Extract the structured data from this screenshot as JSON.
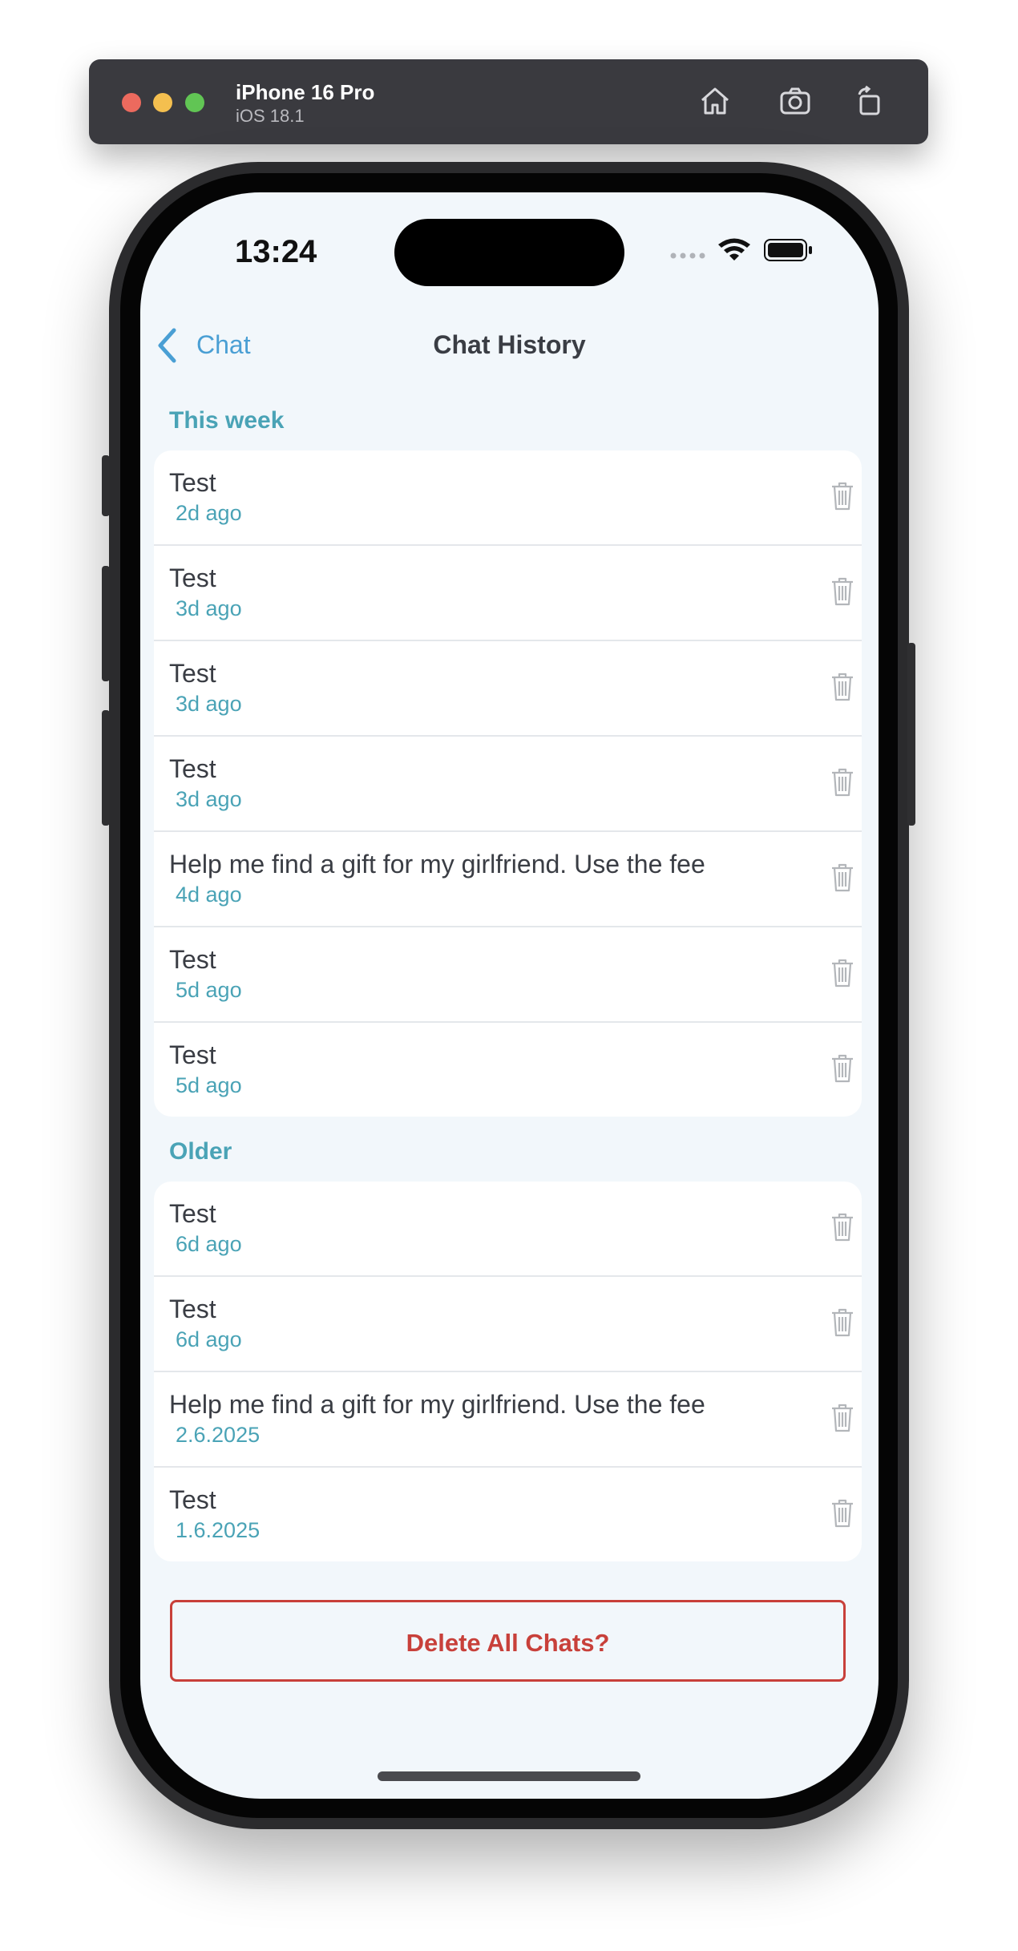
{
  "simulator": {
    "device_name": "iPhone 16 Pro",
    "os_version": "iOS 18.1",
    "toolbar_icons": [
      "home-icon",
      "screenshot-icon",
      "rotate-icon"
    ]
  },
  "status_bar": {
    "time": "13:24",
    "icons": [
      "cellular-icon",
      "wifi-icon",
      "battery-icon"
    ]
  },
  "nav": {
    "back_label": "Chat",
    "title": "Chat History"
  },
  "sections": [
    {
      "header": "This week",
      "items": [
        {
          "title": "Test",
          "time": "2d ago"
        },
        {
          "title": "Test",
          "time": "3d ago"
        },
        {
          "title": "Test",
          "time": "3d ago"
        },
        {
          "title": "Test",
          "time": "3d ago"
        },
        {
          "title": "Help me find a gift for my girlfriend. Use the fee",
          "time": "4d ago"
        },
        {
          "title": "Test",
          "time": "5d ago"
        },
        {
          "title": "Test",
          "time": "5d ago"
        }
      ]
    },
    {
      "header": "Older",
      "items": [
        {
          "title": "Test",
          "time": "6d ago"
        },
        {
          "title": "Test",
          "time": "6d ago"
        },
        {
          "title": "Help me find a gift for my girlfriend. Use the fee",
          "time": "2.6.2025"
        },
        {
          "title": "Test",
          "time": "1.6.2025"
        }
      ]
    }
  ],
  "delete_all_label": "Delete All Chats?",
  "colors": {
    "accent_teal": "#4aa3b6",
    "back_blue": "#4a9fd4",
    "destructive_red": "#c8403a",
    "background": "#f2f7fb"
  }
}
